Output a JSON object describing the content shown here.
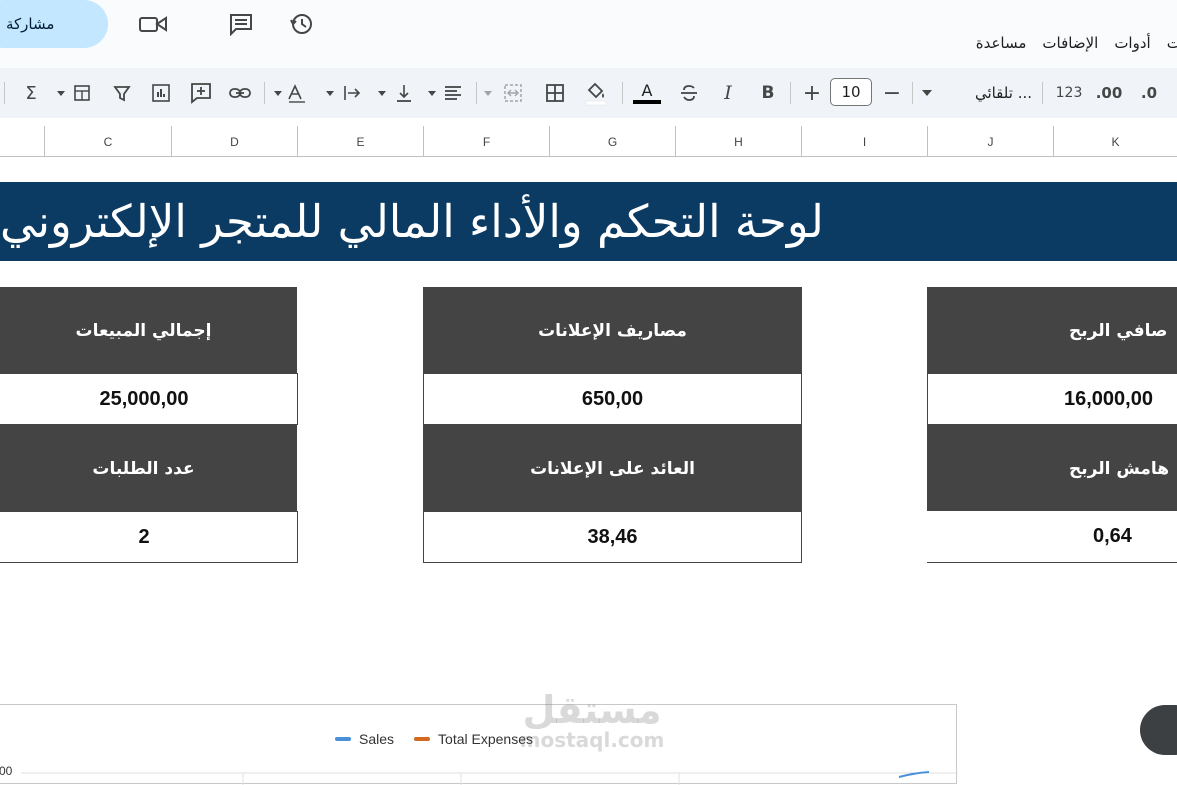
{
  "app": {
    "share_label": "مشاركة",
    "menu": [
      "ات",
      "أدوات",
      "الإضافات",
      "مساعدة"
    ]
  },
  "toolbar": {
    "font_size": "10",
    "font_name": "تلقائي ...",
    "format_123": "123",
    "dec_increase": ".00",
    "dec_decrease": ".0",
    "bold": "B",
    "italic": "I",
    "text_color_letter": "A",
    "minus": "−",
    "plus": "+",
    "sum": "Σ"
  },
  "columns": [
    "C",
    "D",
    "E",
    "F",
    "G",
    "H",
    "I",
    "J",
    "K"
  ],
  "dashboard": {
    "title": "لوحة التحكم والأداء المالي للمتجر الإلكتروني",
    "cards": [
      {
        "label": "إجمالي المبيعات",
        "value": "25,000,00"
      },
      {
        "label": "مصاريف الإعلانات",
        "value": "650,00"
      },
      {
        "label": "صافي الربح",
        "value": "16,000,00"
      },
      {
        "label": "عدد الطلبات",
        "value": "2"
      },
      {
        "label": "العائد على الإعلانات",
        "value": "38,46"
      },
      {
        "label": "هامش الربح",
        "value": "0,64"
      }
    ]
  },
  "watermark": {
    "arabic": "مستقل",
    "latin": "mostaql.com"
  },
  "chart_data": {
    "type": "line",
    "series": [
      {
        "name": "Sales",
        "color": "#4a90d9"
      },
      {
        "name": "Total Expenses",
        "color": "#d2691e"
      }
    ],
    "y_tick_visible": "00"
  }
}
